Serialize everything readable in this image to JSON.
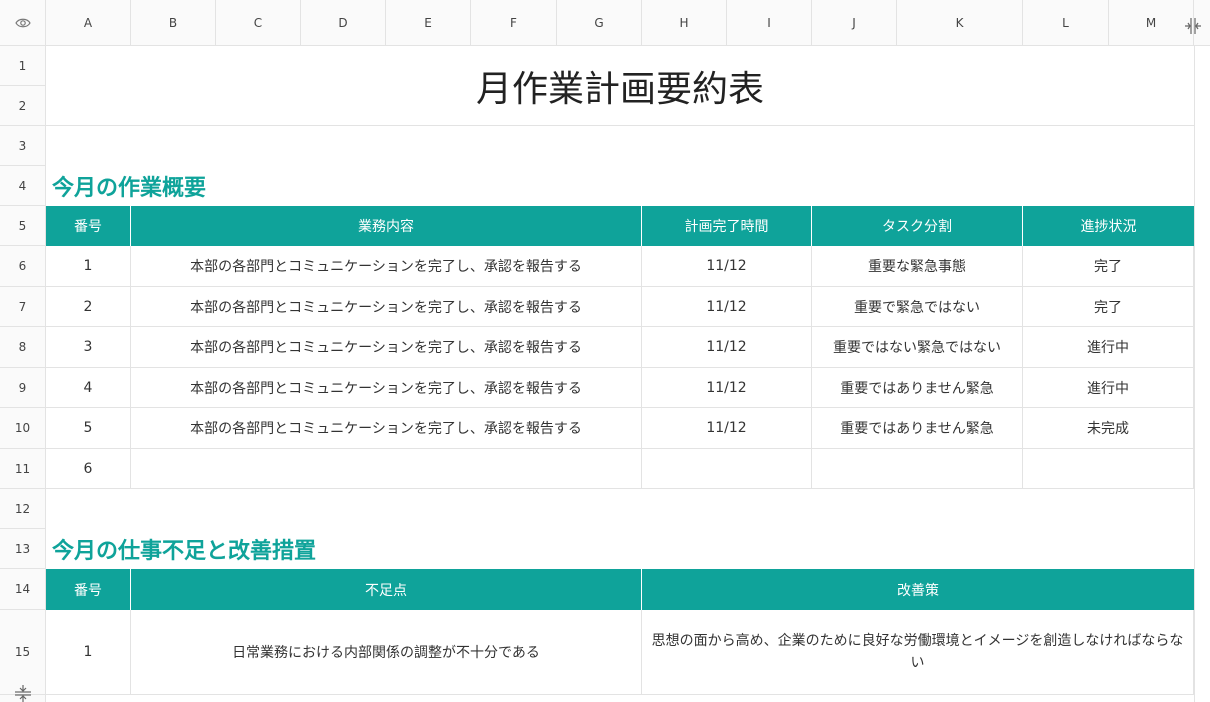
{
  "columns": [
    "A",
    "B",
    "C",
    "D",
    "E",
    "F",
    "G",
    "H",
    "I",
    "J",
    "K",
    "L",
    "M"
  ],
  "rows": [
    "1",
    "2",
    "3",
    "4",
    "5",
    "6",
    "7",
    "8",
    "9",
    "10",
    "11",
    "12",
    "13",
    "14",
    "15"
  ],
  "title": "月作業計画要約表",
  "section1": {
    "heading": "今月の作業概要",
    "headers": [
      "番号",
      "業務内容",
      "計画完了時間",
      "タスク分割",
      "進捗状況"
    ],
    "rows": [
      [
        "1",
        "本部の各部門とコミュニケーションを完了し、承認を報告する",
        "11/12",
        "重要な緊急事態",
        "完了"
      ],
      [
        "2",
        "本部の各部門とコミュニケーションを完了し、承認を報告する",
        "11/12",
        "重要で緊急ではない",
        "完了"
      ],
      [
        "3",
        "本部の各部門とコミュニケーションを完了し、承認を報告する",
        "11/12",
        "重要ではない緊急ではない",
        "進行中"
      ],
      [
        "4",
        "本部の各部門とコミュニケーションを完了し、承認を報告する",
        "11/12",
        "重要ではありません緊急",
        "進行中"
      ],
      [
        "5",
        "本部の各部門とコミュニケーションを完了し、承認を報告する",
        "11/12",
        "重要ではありません緊急",
        "未完成"
      ],
      [
        "6",
        "",
        "",
        "",
        ""
      ]
    ]
  },
  "section2": {
    "heading": "今月の仕事不足と改善措置",
    "headers": [
      "番号",
      "不足点",
      "改善策"
    ],
    "rows": [
      [
        "1",
        "日常業務における内部関係の調整が不十分である",
        "思想の面から高め、企業のために良好な労働環境とイメージを創造しなければならない"
      ]
    ]
  },
  "icons": {
    "corner": "eye-icon",
    "freeze_col": "freeze-column-icon",
    "freeze_row": "freeze-row-icon"
  },
  "colors": {
    "accent": "#0fa39a",
    "header_bg": "#fafafa",
    "grid": "#e3e3e3"
  }
}
